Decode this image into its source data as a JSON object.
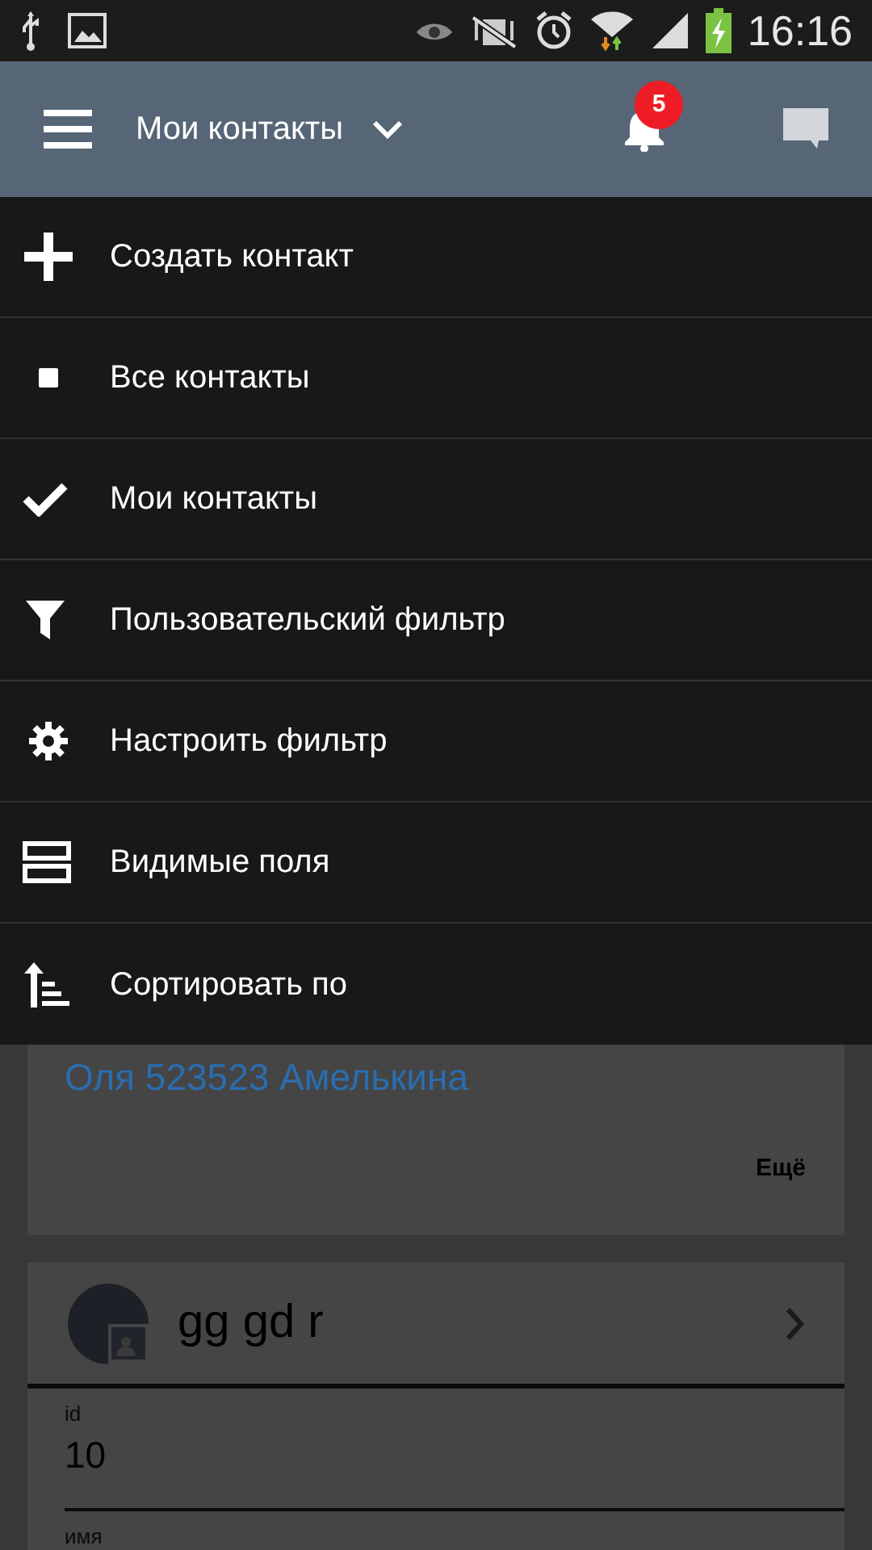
{
  "status_bar": {
    "time": "16:16"
  },
  "app_bar": {
    "title": "Мои контакты",
    "notifications": "5"
  },
  "contacts": [
    {
      "fields": [
        {
          "value": "Оля 523523 Амелькина",
          "kind": "link"
        }
      ],
      "more": "Ещё"
    },
    {
      "name": "gg gd r",
      "fields": [
        {
          "label": "id",
          "value": "10",
          "kind": "text"
        },
        {
          "label": "имя",
          "kind": "text"
        }
      ]
    }
  ],
  "menu": [
    {
      "label": "Создать контакт",
      "kind": "create"
    },
    {
      "label": "Все контакты",
      "kind": "option",
      "selected": false
    },
    {
      "label": "Мои контакты",
      "kind": "option",
      "selected": true
    },
    {
      "label": "Пользовательский фильтр",
      "kind": "custom_filter"
    },
    {
      "label": "Настроить фильтр",
      "kind": "configure"
    },
    {
      "label": "Видимые поля",
      "kind": "fields"
    },
    {
      "label": "Сортировать по",
      "kind": "sort"
    }
  ]
}
